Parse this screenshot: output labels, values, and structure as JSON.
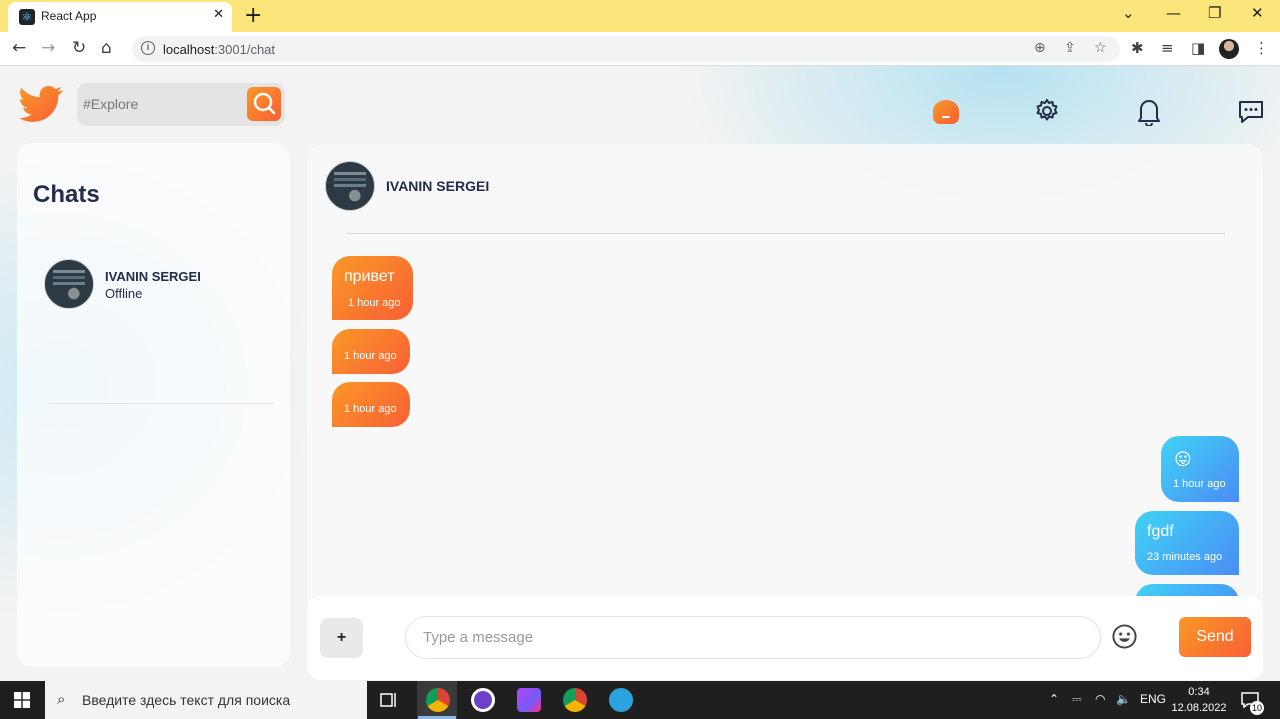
{
  "browser": {
    "tab_title": "React App",
    "url_host": "localhost",
    "url_path": ":3001/chat"
  },
  "header": {
    "search_placeholder": "#Explore"
  },
  "sidebar": {
    "title": "Chats",
    "conversations": [
      {
        "name": "IVANIN SERGEI",
        "status": "Offline"
      }
    ]
  },
  "chat": {
    "contact_name": "IVANIN SERGEI",
    "messages": [
      {
        "direction": "in",
        "text": "привет",
        "time": "1 hour ago"
      },
      {
        "direction": "in",
        "text": "",
        "time": "1 hour ago"
      },
      {
        "direction": "in",
        "text": "",
        "time": "1 hour ago"
      },
      {
        "direction": "out",
        "text": "😛",
        "time": "1 hour ago"
      },
      {
        "direction": "out",
        "text": "fgdf",
        "time": "23 minutes ago"
      }
    ]
  },
  "composer": {
    "attach_label": "+",
    "placeholder": "Type a message",
    "send_label": "Send"
  },
  "taskbar": {
    "search_placeholder": "Введите здесь текст для поиска",
    "language": "ENG",
    "time": "0:34",
    "date": "12.08.2022",
    "notification_count": "10"
  },
  "colors": {
    "accent_orange": "#f99827",
    "accent_blue": "#40d3f5",
    "text_dark": "#242d49"
  }
}
